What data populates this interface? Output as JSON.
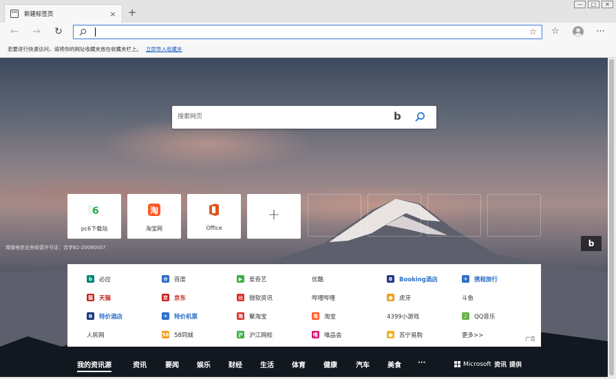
{
  "tab": {
    "title": "新建标签页",
    "close": "×",
    "new_tab": "+"
  },
  "window_controls": [
    "—",
    "□",
    "✕"
  ],
  "toolbar": {
    "back": "←",
    "forward": "→",
    "refresh": "↻",
    "address_value": "",
    "star": "☆",
    "favorites": "☆",
    "menu": "⋯"
  },
  "favbar": {
    "text": "若要进行快速访问，请将你的网址收藏夹放在收藏夹栏上。",
    "link": "立即导入收藏夹"
  },
  "search": {
    "placeholder": "搜索网页",
    "bing": "b"
  },
  "tiles": [
    {
      "label": "pc6下载站",
      "icon": "pc6-icon",
      "color": "#2aa64a"
    },
    {
      "label": "淘宝网",
      "icon": "taobao-icon",
      "color": "#ff5722"
    },
    {
      "label": "Office",
      "icon": "office-icon",
      "color": "#e0531f"
    }
  ],
  "add_tile": "+",
  "icp": "增值电信业务经营许可证：合字B2-20090007",
  "bing_button": "b",
  "links": [
    {
      "label": "必应",
      "style": "plain",
      "icon_color": "#008373",
      "icon_text": "b"
    },
    {
      "label": "百度",
      "style": "plain",
      "icon_color": "#2e6fc8",
      "icon_text": "✿"
    },
    {
      "label": "爱奇艺",
      "style": "plain",
      "icon_color": "#3db04a",
      "icon_text": "▶"
    },
    {
      "label": "优酷",
      "style": "plain",
      "icon_color": "",
      "icon_text": ""
    },
    {
      "label": "Booking酒店",
      "style": "blue",
      "icon_color": "#1f3b80",
      "icon_text": "B"
    },
    {
      "label": "携程旅行",
      "style": "blue",
      "icon_color": "#2e6fc8",
      "icon_text": "✈"
    },
    {
      "label": "天猫",
      "style": "red",
      "icon_color": "#c6241b",
      "icon_text": "猫"
    },
    {
      "label": "京东",
      "style": "red",
      "icon_color": "#c6241b",
      "icon_text": "京"
    },
    {
      "label": "微软资讯",
      "style": "plain",
      "icon_color": "#d9302c",
      "icon_text": "▤"
    },
    {
      "label": "哔哩哔哩",
      "style": "plain",
      "icon_color": "",
      "icon_text": ""
    },
    {
      "label": "虎牙",
      "style": "plain",
      "icon_color": "#f0a020",
      "icon_text": "●"
    },
    {
      "label": "斗鱼",
      "style": "plain",
      "icon_color": "",
      "icon_text": ""
    },
    {
      "label": "特价酒店",
      "style": "blue",
      "icon_color": "#1f3b80",
      "icon_text": "B"
    },
    {
      "label": "特价机票",
      "style": "blue",
      "icon_color": "#2e6fc8",
      "icon_text": "✈"
    },
    {
      "label": "聚淘宝",
      "style": "plain",
      "icon_color": "#d9302c",
      "icon_text": "淘"
    },
    {
      "label": "淘宝",
      "style": "plain",
      "icon_color": "#ff5722",
      "icon_text": "淘"
    },
    {
      "label": "4399小游戏",
      "style": "plain",
      "icon_color": "",
      "icon_text": ""
    },
    {
      "label": "QQ音乐",
      "style": "plain",
      "icon_color": "#6bb34a",
      "icon_text": "♪"
    },
    {
      "label": "人民网",
      "style": "plain",
      "icon_color": "",
      "icon_text": ""
    },
    {
      "label": "58同城",
      "style": "plain",
      "icon_color": "#f0a020",
      "icon_text": "58"
    },
    {
      "label": "沪江网校",
      "style": "plain",
      "icon_color": "#3db04a",
      "icon_text": "沪"
    },
    {
      "label": "唯品会",
      "style": "plain",
      "icon_color": "#d41a74",
      "icon_text": "唯"
    },
    {
      "label": "苏宁易购",
      "style": "plain",
      "icon_color": "#f0b420",
      "icon_text": "●"
    },
    {
      "label": "更多>>",
      "style": "plain",
      "icon_color": "",
      "icon_text": ""
    }
  ],
  "ad_tag": "广告",
  "news": [
    "我的资讯源",
    "资讯",
    "要闻",
    "娱乐",
    "财经",
    "生活",
    "体育",
    "健康",
    "汽车",
    "美食",
    "···"
  ],
  "powered": {
    "brand": "Microsoft",
    "product": "资讯",
    "suffix": "提供"
  }
}
